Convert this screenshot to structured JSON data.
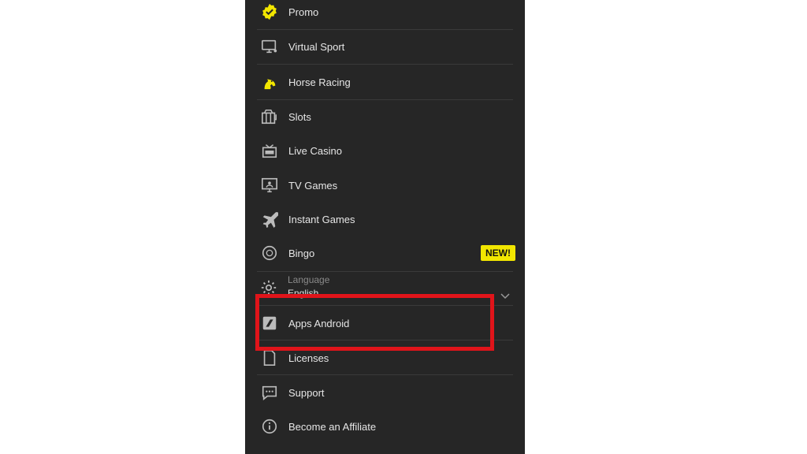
{
  "menu": {
    "items": [
      {
        "label": "Promo",
        "icon": "promo-badge-icon"
      },
      {
        "label": "Virtual Sport",
        "icon": "monitor-icon"
      },
      {
        "label": "Horse Racing",
        "icon": "horse-icon"
      },
      {
        "label": "Slots",
        "icon": "slot-machine-icon"
      },
      {
        "label": "Live Casino",
        "icon": "live-casino-icon"
      },
      {
        "label": "TV Games",
        "icon": "tv-icon"
      },
      {
        "label": "Instant Games",
        "icon": "plane-icon"
      },
      {
        "label": "Bingo",
        "icon": "bingo-ball-icon"
      }
    ],
    "bingo_badge": "NEW!",
    "language": {
      "title": "Language",
      "value": "English"
    },
    "items_after": [
      {
        "label": "Apps Android",
        "icon": "android-app-icon"
      },
      {
        "label": "Licenses",
        "icon": "document-icon"
      },
      {
        "label": "Support",
        "icon": "chat-icon"
      },
      {
        "label": "Become an Affiliate",
        "icon": "info-icon"
      }
    ]
  },
  "colors": {
    "accent": "#f2e600",
    "highlight": "#e0141a",
    "background": "#262626"
  }
}
